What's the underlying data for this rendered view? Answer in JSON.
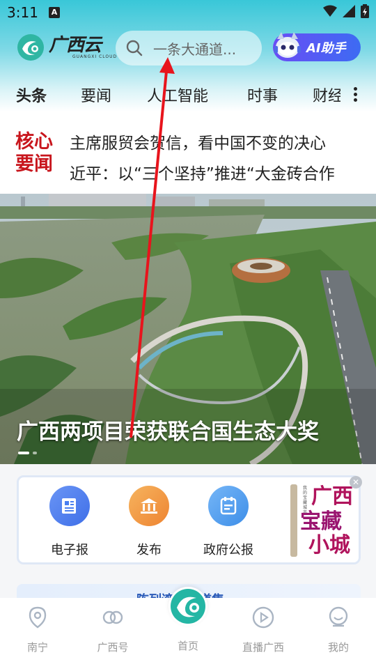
{
  "status_bar": {
    "time": "3:11",
    "notif": "A"
  },
  "header": {
    "logo_cn": "广西云",
    "logo_en": "GUANGXI CLOUD",
    "search_placeholder": "一条大通道...",
    "ai_button_label": "AI助手"
  },
  "tabs": [
    "头条",
    "要闻",
    "人工智能",
    "时事",
    "财经"
  ],
  "core_news": {
    "badge_line1": "核心",
    "badge_line2": "要闻",
    "items": [
      "主席服贸会贺信，看中国不变的决心",
      "近平：以“三个坚持”推进“大金砖合作"
    ]
  },
  "hero": {
    "title": "广西两项目荣获联合国生态大奖",
    "slide_count": 2,
    "active_slide": 0
  },
  "services": {
    "items": [
      {
        "label": "电子报",
        "icon": "newspaper-icon",
        "color": "#4a7ff0"
      },
      {
        "label": "发布",
        "icon": "bank-icon",
        "color": "#f19a3e"
      },
      {
        "label": "政府公报",
        "icon": "document-icon",
        "color": "#4a9df0"
      }
    ],
    "promo_line1": "广西",
    "promo_line2": "宝藏",
    "promo_line3": "小城",
    "promo_side_text": "我的宝藏城市"
  },
  "banner_peek": "陈列湾…展道集",
  "bottom_nav": [
    {
      "label": "南宁",
      "icon": "location-icon"
    },
    {
      "label": "广西号",
      "icon": "link-icon"
    },
    {
      "label": "首页",
      "icon": "home-logo-icon"
    },
    {
      "label": "直播广西",
      "icon": "play-icon"
    },
    {
      "label": "我的",
      "icon": "profile-icon"
    }
  ],
  "colors": {
    "accent": "#20b6c9",
    "brand_red": "#c8161d",
    "annotation_arrow": "#e8141c"
  }
}
